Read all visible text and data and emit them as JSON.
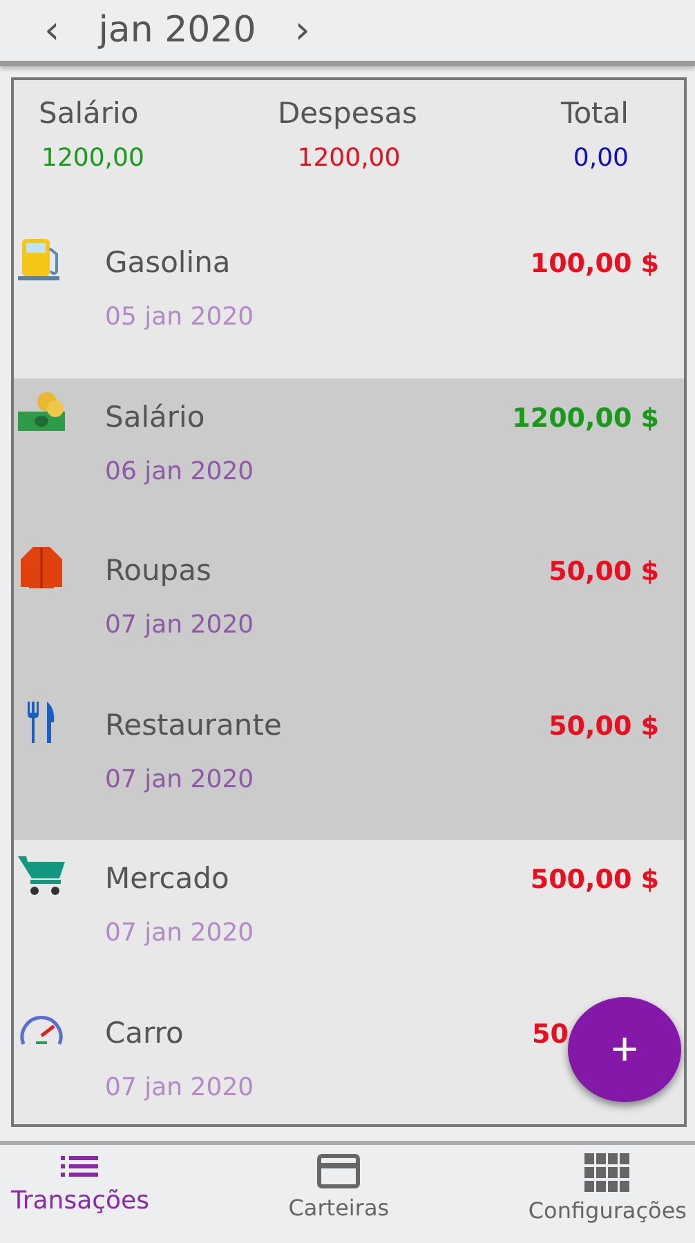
{
  "header": {
    "prev": "‹",
    "month": "jan 2020",
    "next": "›"
  },
  "summary": [
    {
      "label": "Salário",
      "value": "1200,00",
      "kind": "income"
    },
    {
      "label": "Despesas",
      "value": "1200,00",
      "kind": "expense"
    },
    {
      "label": "Total",
      "value": "0,00",
      "kind": "total"
    }
  ],
  "transactions": [
    {
      "name": "Gasolina",
      "date": "05 jan 2020",
      "amount": "100,00 $",
      "kind": "expense",
      "selected": false
    },
    {
      "name": "Salário",
      "date": "06 jan 2020",
      "amount": "1200,00 $",
      "kind": "income",
      "selected": true
    },
    {
      "name": "Roupas",
      "date": "07 jan 2020",
      "amount": "50,00 $",
      "kind": "expense",
      "selected": true
    },
    {
      "name": "Restaurante",
      "date": "07 jan 2020",
      "amount": "50,00 $",
      "kind": "expense",
      "selected": true
    },
    {
      "name": "Mercado",
      "date": "07 jan 2020",
      "amount": "500,00 $",
      "kind": "expense",
      "selected": false
    },
    {
      "name": "Carro",
      "date": "07 jan 2020",
      "amount": "50",
      "kind": "expense",
      "selected": false,
      "truncated": true
    }
  ],
  "fab": "+",
  "tabs": [
    {
      "label": "Transações",
      "selected": true
    },
    {
      "label": "Carteiras",
      "selected": false
    },
    {
      "label": "Configurações",
      "selected": false
    }
  ]
}
